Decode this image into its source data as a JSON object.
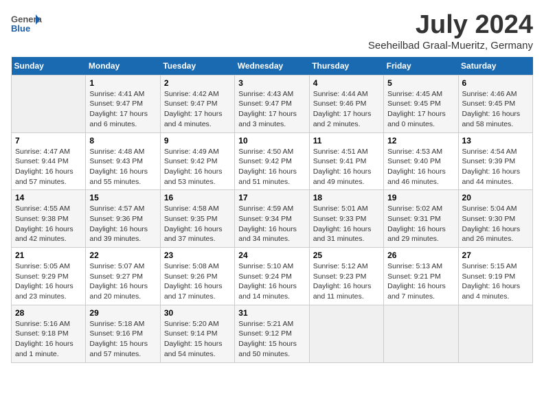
{
  "logo": {
    "general": "General",
    "blue": "Blue"
  },
  "title": "July 2024",
  "location": "Seeheilbad Graal-Mueritz, Germany",
  "weekdays": [
    "Sunday",
    "Monday",
    "Tuesday",
    "Wednesday",
    "Thursday",
    "Friday",
    "Saturday"
  ],
  "weeks": [
    [
      {
        "day": "",
        "content": ""
      },
      {
        "day": "1",
        "content": "Sunrise: 4:41 AM\nSunset: 9:47 PM\nDaylight: 17 hours\nand 6 minutes."
      },
      {
        "day": "2",
        "content": "Sunrise: 4:42 AM\nSunset: 9:47 PM\nDaylight: 17 hours\nand 4 minutes."
      },
      {
        "day": "3",
        "content": "Sunrise: 4:43 AM\nSunset: 9:47 PM\nDaylight: 17 hours\nand 3 minutes."
      },
      {
        "day": "4",
        "content": "Sunrise: 4:44 AM\nSunset: 9:46 PM\nDaylight: 17 hours\nand 2 minutes."
      },
      {
        "day": "5",
        "content": "Sunrise: 4:45 AM\nSunset: 9:45 PM\nDaylight: 17 hours\nand 0 minutes."
      },
      {
        "day": "6",
        "content": "Sunrise: 4:46 AM\nSunset: 9:45 PM\nDaylight: 16 hours\nand 58 minutes."
      }
    ],
    [
      {
        "day": "7",
        "content": "Sunrise: 4:47 AM\nSunset: 9:44 PM\nDaylight: 16 hours\nand 57 minutes."
      },
      {
        "day": "8",
        "content": "Sunrise: 4:48 AM\nSunset: 9:43 PM\nDaylight: 16 hours\nand 55 minutes."
      },
      {
        "day": "9",
        "content": "Sunrise: 4:49 AM\nSunset: 9:42 PM\nDaylight: 16 hours\nand 53 minutes."
      },
      {
        "day": "10",
        "content": "Sunrise: 4:50 AM\nSunset: 9:42 PM\nDaylight: 16 hours\nand 51 minutes."
      },
      {
        "day": "11",
        "content": "Sunrise: 4:51 AM\nSunset: 9:41 PM\nDaylight: 16 hours\nand 49 minutes."
      },
      {
        "day": "12",
        "content": "Sunrise: 4:53 AM\nSunset: 9:40 PM\nDaylight: 16 hours\nand 46 minutes."
      },
      {
        "day": "13",
        "content": "Sunrise: 4:54 AM\nSunset: 9:39 PM\nDaylight: 16 hours\nand 44 minutes."
      }
    ],
    [
      {
        "day": "14",
        "content": "Sunrise: 4:55 AM\nSunset: 9:38 PM\nDaylight: 16 hours\nand 42 minutes."
      },
      {
        "day": "15",
        "content": "Sunrise: 4:57 AM\nSunset: 9:36 PM\nDaylight: 16 hours\nand 39 minutes."
      },
      {
        "day": "16",
        "content": "Sunrise: 4:58 AM\nSunset: 9:35 PM\nDaylight: 16 hours\nand 37 minutes."
      },
      {
        "day": "17",
        "content": "Sunrise: 4:59 AM\nSunset: 9:34 PM\nDaylight: 16 hours\nand 34 minutes."
      },
      {
        "day": "18",
        "content": "Sunrise: 5:01 AM\nSunset: 9:33 PM\nDaylight: 16 hours\nand 31 minutes."
      },
      {
        "day": "19",
        "content": "Sunrise: 5:02 AM\nSunset: 9:31 PM\nDaylight: 16 hours\nand 29 minutes."
      },
      {
        "day": "20",
        "content": "Sunrise: 5:04 AM\nSunset: 9:30 PM\nDaylight: 16 hours\nand 26 minutes."
      }
    ],
    [
      {
        "day": "21",
        "content": "Sunrise: 5:05 AM\nSunset: 9:29 PM\nDaylight: 16 hours\nand 23 minutes."
      },
      {
        "day": "22",
        "content": "Sunrise: 5:07 AM\nSunset: 9:27 PM\nDaylight: 16 hours\nand 20 minutes."
      },
      {
        "day": "23",
        "content": "Sunrise: 5:08 AM\nSunset: 9:26 PM\nDaylight: 16 hours\nand 17 minutes."
      },
      {
        "day": "24",
        "content": "Sunrise: 5:10 AM\nSunset: 9:24 PM\nDaylight: 16 hours\nand 14 minutes."
      },
      {
        "day": "25",
        "content": "Sunrise: 5:12 AM\nSunset: 9:23 PM\nDaylight: 16 hours\nand 11 minutes."
      },
      {
        "day": "26",
        "content": "Sunrise: 5:13 AM\nSunset: 9:21 PM\nDaylight: 16 hours\nand 7 minutes."
      },
      {
        "day": "27",
        "content": "Sunrise: 5:15 AM\nSunset: 9:19 PM\nDaylight: 16 hours\nand 4 minutes."
      }
    ],
    [
      {
        "day": "28",
        "content": "Sunrise: 5:16 AM\nSunset: 9:18 PM\nDaylight: 16 hours\nand 1 minute."
      },
      {
        "day": "29",
        "content": "Sunrise: 5:18 AM\nSunset: 9:16 PM\nDaylight: 15 hours\nand 57 minutes."
      },
      {
        "day": "30",
        "content": "Sunrise: 5:20 AM\nSunset: 9:14 PM\nDaylight: 15 hours\nand 54 minutes."
      },
      {
        "day": "31",
        "content": "Sunrise: 5:21 AM\nSunset: 9:12 PM\nDaylight: 15 hours\nand 50 minutes."
      },
      {
        "day": "",
        "content": ""
      },
      {
        "day": "",
        "content": ""
      },
      {
        "day": "",
        "content": ""
      }
    ]
  ]
}
